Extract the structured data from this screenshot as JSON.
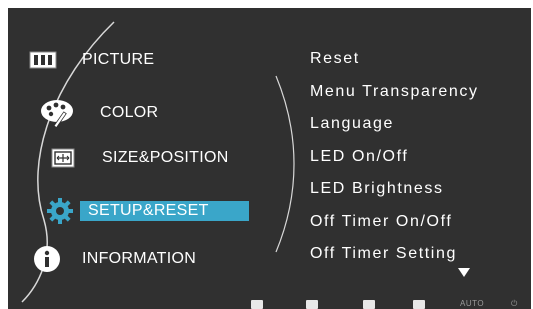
{
  "menu": {
    "items": [
      {
        "label": "PICTURE",
        "icon": "picture-icon"
      },
      {
        "label": "COLOR",
        "icon": "color-palette-icon"
      },
      {
        "label": "SIZE&POSITION",
        "icon": "size-position-icon"
      },
      {
        "label": "SETUP&RESET",
        "icon": "gear-icon",
        "selected": true
      },
      {
        "label": "INFORMATION",
        "icon": "info-icon"
      }
    ]
  },
  "submenu": {
    "items": [
      "Reset",
      "Menu Transparency",
      "Language",
      "LED On/Off",
      "LED Brightness",
      "Off Timer On/Off",
      "Off Timer Setting"
    ],
    "more_indicator": "scroll-down-arrow-icon"
  },
  "keybar": {
    "auto_label": "AUTO",
    "keys": [
      "close-key-icon",
      "down-key-icon",
      "up-key-icon",
      "enter-key-icon",
      "auto-key-label",
      "power-icon"
    ]
  },
  "colors": {
    "background": "#303030",
    "selected_highlight": "#3aa6c9",
    "text": "#ffffff"
  }
}
